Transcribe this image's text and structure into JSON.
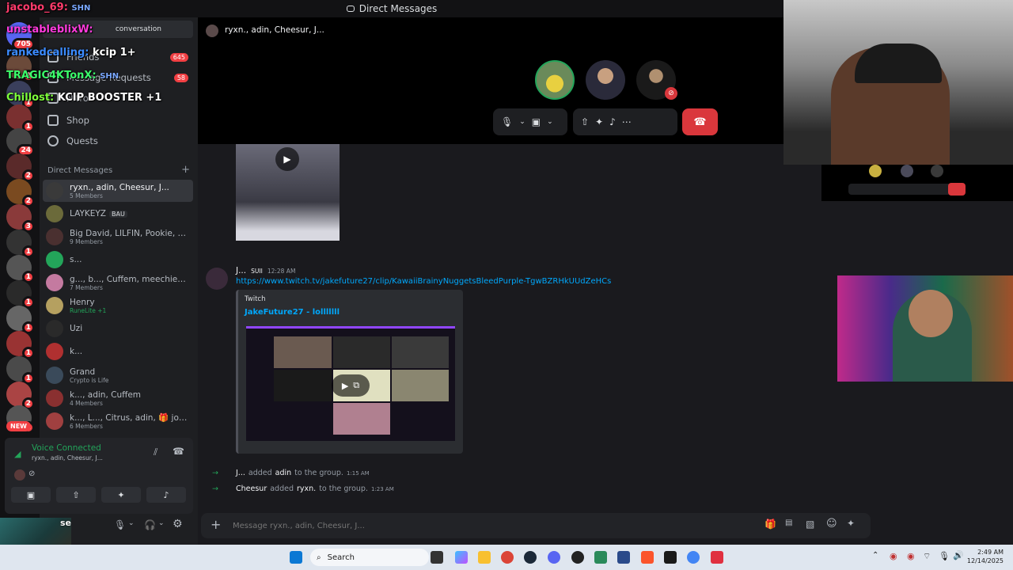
{
  "window": {
    "title": "Direct Messages"
  },
  "rail": {
    "badges": [
      "705",
      "2",
      "1",
      "1",
      "24",
      "2",
      "2",
      "3",
      "1",
      "1",
      "1",
      "1",
      "1",
      "1",
      "2",
      "1"
    ],
    "new_label": "NEW"
  },
  "sidebar": {
    "conversation_label": "conversation",
    "friends_label": "Friends",
    "message_requests_label": "Message Requests",
    "nitro_label": "Nitro",
    "shop_label": "Shop",
    "quests_label": "Quests",
    "friends_badge": "645",
    "requests_badge": "58",
    "dm_header": "Direct Messages",
    "dms": [
      {
        "name": "ryxn., adin, Cheesur, J...",
        "sub": "5 Members"
      },
      {
        "name": "LAYKEYZ",
        "sub": "",
        "tag": "BAU"
      },
      {
        "name": "Big David, LILFIN, Pookie, Ch...",
        "sub": "9 Members"
      },
      {
        "name": "s...",
        "sub": ""
      },
      {
        "name": "g..., b..., Cuffem, meechie, J...,...",
        "sub": "7 Members"
      },
      {
        "name": "Henry",
        "sub": "RuneLite +1"
      },
      {
        "name": "Uzi",
        "sub": ""
      },
      {
        "name": "k...",
        "sub": ""
      },
      {
        "name": "Grand",
        "sub": "Crypto is Life"
      },
      {
        "name": "k..., adin, Cuffem",
        "sub": "4 Members"
      },
      {
        "name": "k..., L..., Citrus, adin, 🎁 jolly j...",
        "sub": "6 Members"
      }
    ]
  },
  "voice": {
    "status": "Voice Connected",
    "channel": "ryxn., adin, Cheesur, J..."
  },
  "call": {
    "title": "ryxn., adin, Cheesur, J..."
  },
  "chat": {
    "message": {
      "author": "J...",
      "badge": "SUII",
      "time": "12:28 AM",
      "link": "https://www.twitch.tv/jakefuture27/clip/KawaiiBrainyNuggetsBleedPurple-TgwBZRHkUUdZeHCs",
      "embed_provider": "Twitch",
      "embed_title": "JakeFuture27 - lolllllll"
    },
    "system": [
      {
        "actor": "J...",
        "action": "added",
        "target": "adin",
        "rest": "to the group.",
        "time": "1:15 AM"
      },
      {
        "actor": "Cheesur",
        "action": "added",
        "target": "ryxn.",
        "rest": "to the group.",
        "time": "1:23 AM"
      }
    ],
    "composer_placeholder": "Message ryxn., adin, Cheesur, J..."
  },
  "overlay": {
    "lines": [
      {
        "user": "jacobo_69:",
        "msg": "SHN",
        "color": "#ff3b6b"
      },
      {
        "user": "unstableblixW:",
        "msg": "",
        "color": "#ff3bdc"
      },
      {
        "user": "rankedcalling:",
        "msg": "kcip 1+",
        "color": "#3b8bff"
      },
      {
        "user": "TRAGIC4KTonX:",
        "msg": "SHN",
        "color": "#3bff6b"
      },
      {
        "user": "Chillost:",
        "msg": "KCIP BOOSTER +1",
        "color": "#7dff3b"
      }
    ],
    "cam_text": "se"
  },
  "taskbar": {
    "search_label": "Search",
    "time": "2:49 AM",
    "date": "12/14/2025"
  },
  "colors": {
    "accent": "#5865f2",
    "danger": "#da373c",
    "link": "#00a8fc",
    "green": "#23a55a"
  }
}
